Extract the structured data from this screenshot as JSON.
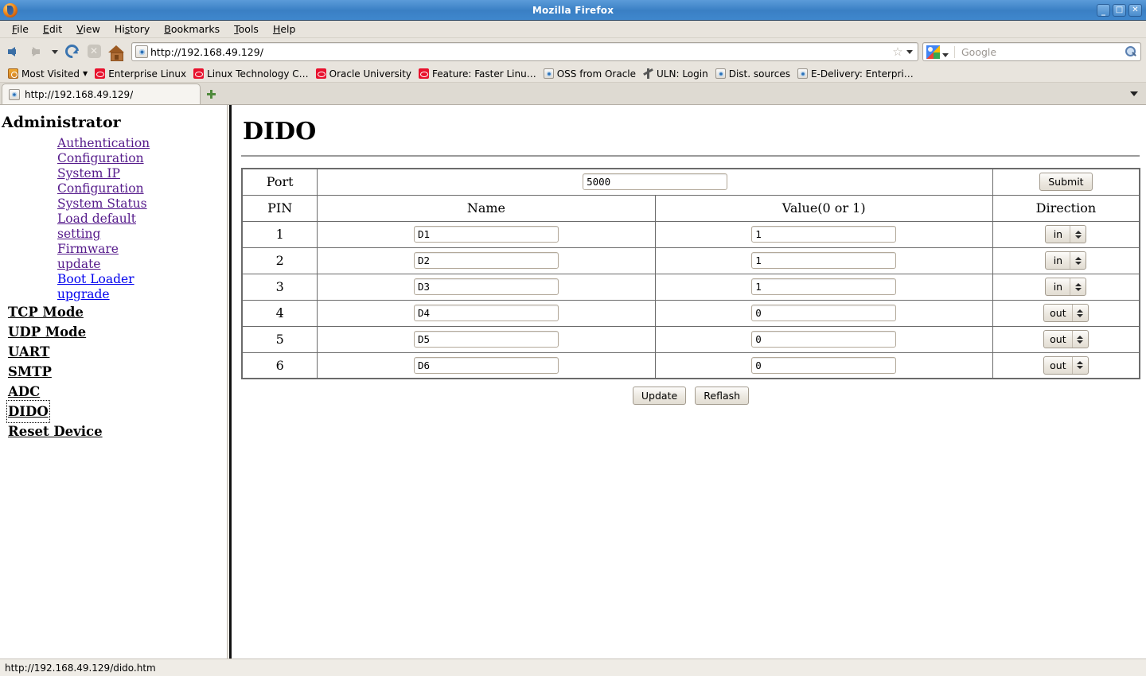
{
  "window": {
    "title": "Mozilla Firefox",
    "controls": {
      "minimize": "_",
      "maximize": "□",
      "close": "✕"
    },
    "app_icon": "firefox-icon"
  },
  "menubar": {
    "items": [
      {
        "label": "File",
        "accel": "F"
      },
      {
        "label": "Edit",
        "accel": "E"
      },
      {
        "label": "View",
        "accel": "V"
      },
      {
        "label": "History",
        "accel": "s"
      },
      {
        "label": "Bookmarks",
        "accel": "B"
      },
      {
        "label": "Tools",
        "accel": "T"
      },
      {
        "label": "Help",
        "accel": "H"
      }
    ]
  },
  "toolbar": {
    "back_icon": "back-arrow-icon",
    "forward_icon": "forward-arrow-icon",
    "history_dropdown_icon": "chevron-down-icon",
    "reload_icon": "reload-icon",
    "stop_icon": "stop-icon",
    "stop_glyph": "✕",
    "home_icon": "home-icon",
    "url": "http://192.168.49.129/",
    "star_glyph": "☆",
    "url_dropdown_icon": "chevron-down-icon",
    "search_engine": "Google",
    "search_placeholder": "Google",
    "search_icon": "magnifier-icon"
  },
  "bookmarks": {
    "items": [
      {
        "label": "Most Visited",
        "icon": "folder-icon",
        "caret": "▼"
      },
      {
        "label": "Enterprise Linux",
        "icon": "oracle-icon"
      },
      {
        "label": "Linux Technology C…",
        "icon": "oracle-icon"
      },
      {
        "label": "Oracle University",
        "icon": "oracle-icon"
      },
      {
        "label": "Feature: Faster Linu…",
        "icon": "oracle-icon"
      },
      {
        "label": "OSS from Oracle",
        "icon": "page-icon"
      },
      {
        "label": "ULN: Login",
        "icon": "uln-icon"
      },
      {
        "label": "Dist. sources",
        "icon": "page-icon"
      },
      {
        "label": "E-Delivery: Enterpri…",
        "icon": "page-icon"
      }
    ]
  },
  "tabs": {
    "active": {
      "label": "http://192.168.49.129/",
      "icon": "page-icon"
    },
    "new_tab_icon": "plus-icon",
    "tab_list_icon": "chevron-down-icon"
  },
  "sidebar": {
    "heading": "Administrator",
    "sub_links": [
      {
        "label": "Authentication Configuration",
        "state": "visited"
      },
      {
        "label": "System IP Configuration",
        "state": "visited"
      },
      {
        "label": "System Status",
        "state": "visited"
      },
      {
        "label": "Load default setting",
        "state": "visited"
      },
      {
        "label": "Firmware update",
        "state": "visited"
      },
      {
        "label": "Boot Loader upgrade",
        "state": "unvisited"
      }
    ],
    "top_links": [
      {
        "label": "TCP Mode",
        "focused": false
      },
      {
        "label": "UDP Mode",
        "focused": false
      },
      {
        "label": "UART",
        "focused": false
      },
      {
        "label": "SMTP",
        "focused": false
      },
      {
        "label": "ADC",
        "focused": false
      },
      {
        "label": "DIDO",
        "focused": true
      },
      {
        "label": "Reset Device",
        "focused": false
      }
    ]
  },
  "main": {
    "page_title": "DIDO",
    "port_row": {
      "label": "Port",
      "value": "5000",
      "submit_label": "Submit"
    },
    "columns": [
      "PIN",
      "Name",
      "Value(0 or 1)",
      "Direction"
    ],
    "rows": [
      {
        "pin": "1",
        "name": "D1",
        "value": "1",
        "direction": "in"
      },
      {
        "pin": "2",
        "name": "D2",
        "value": "1",
        "direction": "in"
      },
      {
        "pin": "3",
        "name": "D3",
        "value": "1",
        "direction": "in"
      },
      {
        "pin": "4",
        "name": "D4",
        "value": "0",
        "direction": "out"
      },
      {
        "pin": "5",
        "name": "D5",
        "value": "0",
        "direction": "out"
      },
      {
        "pin": "6",
        "name": "D6",
        "value": "0",
        "direction": "out"
      }
    ],
    "direction_options": [
      "in",
      "out"
    ],
    "update_label": "Update",
    "reflash_label": "Reflash"
  },
  "statusbar": {
    "text": "http://192.168.49.129/dido.htm"
  },
  "colors": {
    "titlebar": "#3f87cd",
    "chrome": "#e8e4dd",
    "link_visited": "#551a8b",
    "link_unvisited": "#0000ee",
    "oracle_red": "#e8112d"
  }
}
